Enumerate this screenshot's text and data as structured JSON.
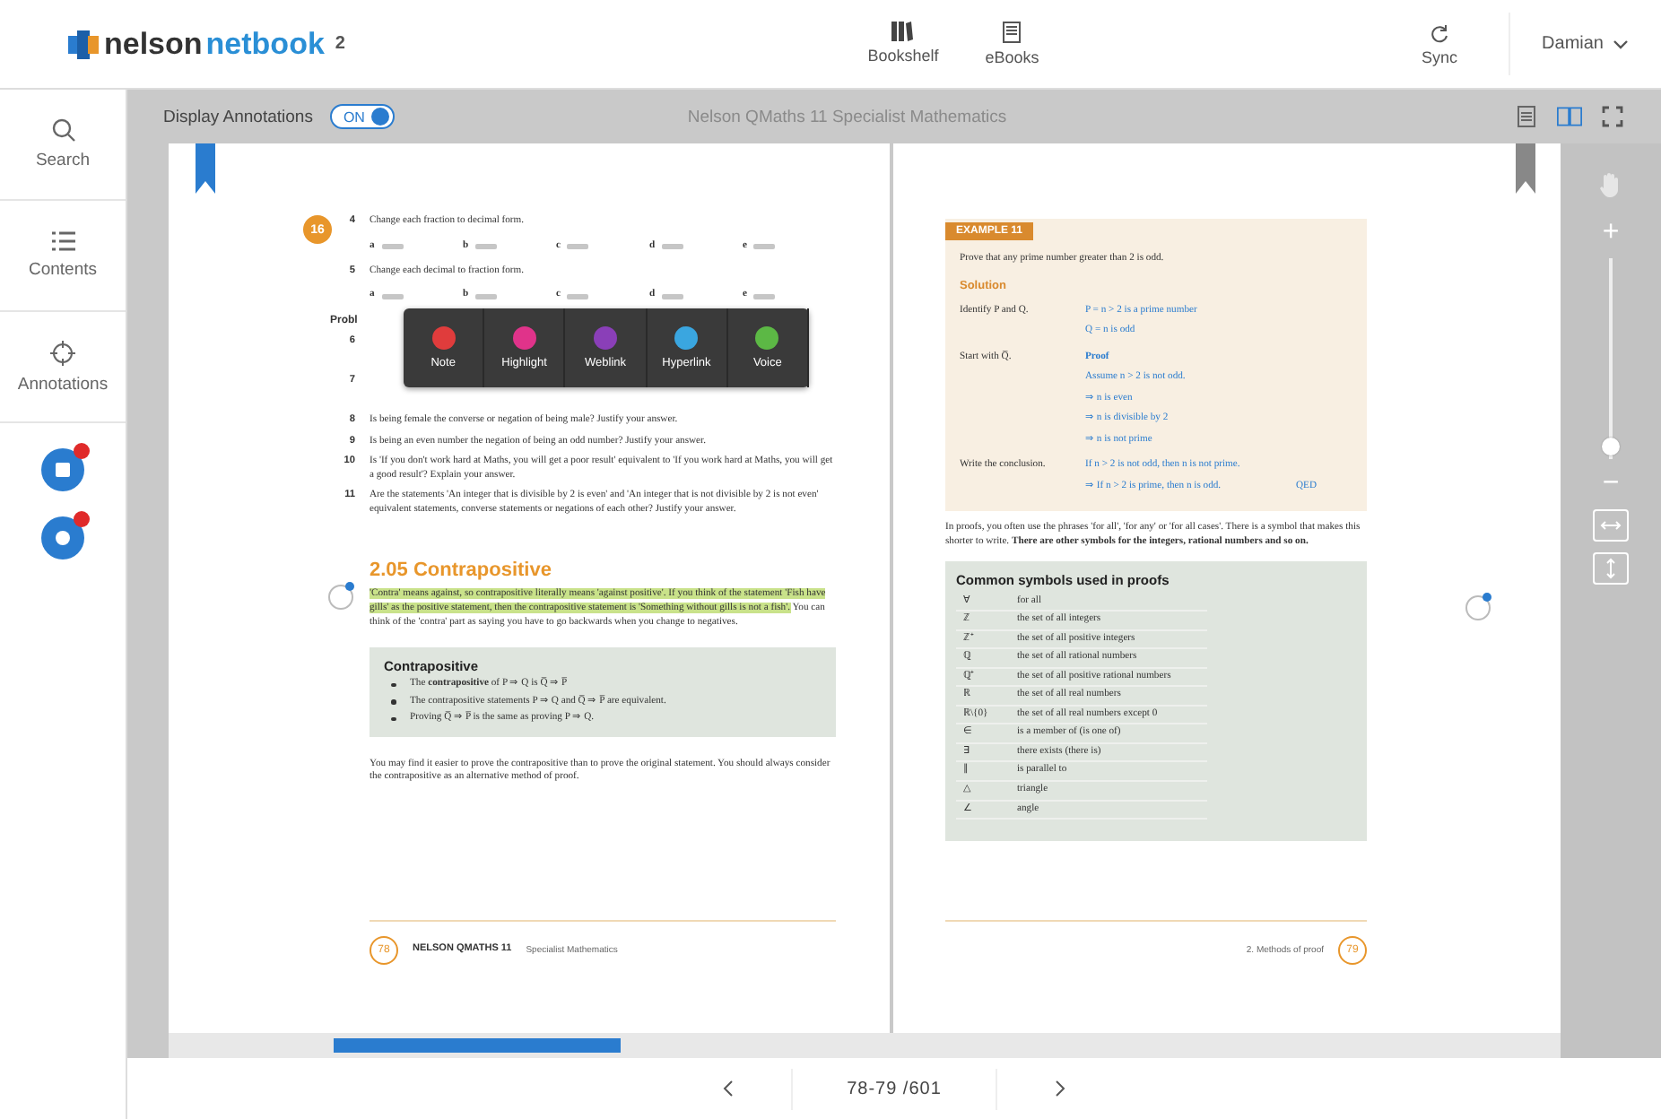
{
  "header": {
    "logo": {
      "part_a": "nelson",
      "part_b": "netbook",
      "superscript": "2"
    },
    "nav": [
      {
        "label": "Bookshelf"
      },
      {
        "label": "eBooks"
      }
    ],
    "sync": "Sync",
    "user": "Damian"
  },
  "sidebar": {
    "items": [
      {
        "label": "Search"
      },
      {
        "label": "Contents"
      },
      {
        "label": "Annotations"
      }
    ]
  },
  "toolbar": {
    "annotations_label": "Display Annotations",
    "toggle": {
      "label": "ON",
      "on": true
    },
    "title": "Nelson QMaths 11 Specialist Mathematics",
    "views": [
      {
        "selected": false
      },
      {
        "selected": true
      }
    ]
  },
  "left_page": {
    "exercise_badge": "16",
    "exercises": [
      {
        "number": "4",
        "text": "Change each fraction to decimal form.",
        "parts": [
          "a",
          "b",
          "c",
          "d",
          "e"
        ]
      },
      {
        "number": "5",
        "text": "Change each decimal to fraction form.",
        "parts": [
          "a",
          "b",
          "c",
          "d",
          "e"
        ]
      }
    ],
    "heading_cut": "Probl",
    "covered_numbers": [
      "6",
      "7"
    ],
    "questions": [
      {
        "number": "8",
        "text": "Is being female the converse or negation of being male? Justify your answer."
      },
      {
        "number": "9",
        "text": "Is being an even number the negation of being an odd number? Justify your answer."
      },
      {
        "number": "10",
        "text": "Is 'If you don't work hard at Maths, you will get a poor result' equivalent to 'If you work hard at Maths, you will get a good result'? Explain your answer."
      },
      {
        "number": "11",
        "text": "Are the statements 'An integer that is divisible by 2 is even' and 'An integer that is not divisible by 2 is not even' equivalent statements, converse statements or negations of each other? Justify your answer."
      }
    ],
    "section_title": "2.05 Contrapositive",
    "intro": {
      "highlighted": "'Contra' means against, so contrapositive literally means 'against positive'. If you think of the statement 'Fish have gills' as the positive statement, then the contrapositive statement is 'Something without gills is not a fish'.",
      "rest": " You can think of the 'contra' part as saying you have to go backwards when you change to negatives."
    },
    "box": {
      "title": "Contrapositive",
      "bullets": [
        "The **contrapositive** of P ⇒ Q is Q̅ ⇒ P̅",
        "The contrapositive statements P ⇒ Q and Q̅ ⇒ P̅ are equivalent.",
        "Proving Q̅ ⇒ P̅ is the same as proving P ⇒ Q."
      ]
    },
    "closing": "You may find it easier to prove the contrapositive than to prove the original statement. You should always consider the contrapositive as an alternative method of proof.",
    "footer": {
      "page": "78",
      "book": "NELSON QMATHS 11",
      "subject": "Specialist Mathematics"
    }
  },
  "annotation_tools": [
    {
      "label": "Note",
      "color": "#e03c3c"
    },
    {
      "label": "Highlight",
      "color": "#e0338a"
    },
    {
      "label": "Weblink",
      "color": "#8a3fb8"
    },
    {
      "label": "Hyperlink",
      "color": "#3aa6e0"
    },
    {
      "label": "Voice",
      "color": "#5cb845"
    }
  ],
  "right_page": {
    "example": {
      "tag": "EXAMPLE 11",
      "prompt": "Prove that any prime number greater than 2 is odd.",
      "solution_label": "Solution",
      "steps": [
        {
          "label": "Identify P and Q.",
          "lines": [
            "P = n > 2 is a prime number",
            "Q = n is odd"
          ]
        },
        {
          "label": "Start with Q̅.",
          "lines": [
            "**Proof**",
            "Assume n > 2 is not odd.",
            "⇒ n is even",
            "⇒ n is divisible by 2",
            "⇒ n is not prime"
          ]
        },
        {
          "label": "Write the conclusion.",
          "lines": [
            "If n > 2 is not odd, then n is not prime.",
            "⇒ If n > 2 is prime, then n is odd."
          ],
          "end": "QED"
        }
      ]
    },
    "paragraph": "In proofs, you often use the phrases 'for all', 'for any' or 'for all cases'. There is a symbol that makes this shorter to write. **There are other symbols for the integers, rational numbers and so on.**",
    "symbols": {
      "title": "Common symbols used in proofs",
      "rows": [
        [
          "∀",
          "for all"
        ],
        [
          "ℤ",
          "the set of all integers"
        ],
        [
          "ℤ⁺",
          "the set of all positive integers"
        ],
        [
          "ℚ",
          "the set of all rational numbers"
        ],
        [
          "ℚ⁺",
          "the set of all positive rational numbers"
        ],
        [
          "ℝ",
          "the set of all real numbers"
        ],
        [
          "ℝ\\{0}",
          "the set of all real numbers except 0"
        ],
        [
          "∈",
          "is a member of (is one of)"
        ],
        [
          "∃",
          "there exists (there is)"
        ],
        [
          "∥",
          "is parallel to"
        ],
        [
          "△",
          "triangle"
        ],
        [
          "∠",
          "angle"
        ]
      ]
    },
    "footer": {
      "chapter": "2. Methods of proof",
      "page": "79"
    }
  },
  "zoom": {
    "zoom_in": "+",
    "level": 0.06,
    "zoom_out": "−"
  },
  "pager": {
    "pages": "78-79 /601"
  }
}
